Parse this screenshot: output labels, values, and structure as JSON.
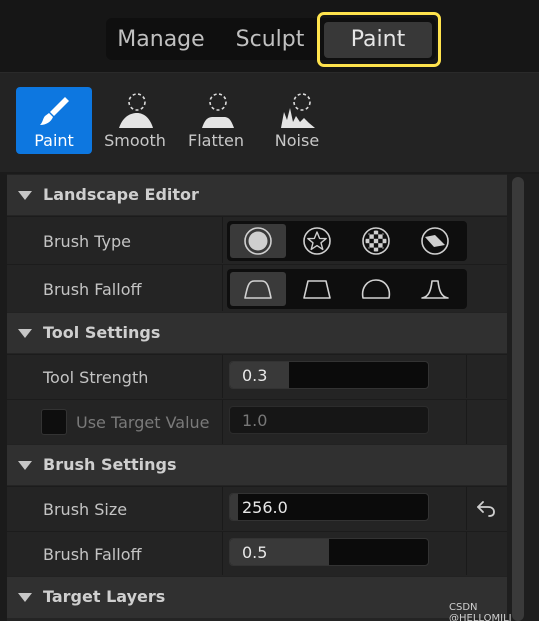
{
  "modes": {
    "tabs": [
      {
        "label": "Manage",
        "active": false
      },
      {
        "label": "Sculpt",
        "active": false
      },
      {
        "label": "Paint",
        "active": true
      }
    ],
    "highlight_color": "#ffe34d"
  },
  "tools": [
    {
      "label": "Paint",
      "icon": "paint-brush-icon",
      "active": true
    },
    {
      "label": "Smooth",
      "icon": "smooth-icon",
      "active": false
    },
    {
      "label": "Flatten",
      "icon": "flatten-icon",
      "active": false
    },
    {
      "label": "Noise",
      "icon": "noise-icon",
      "active": false
    }
  ],
  "sections": {
    "landscape_editor": "Landscape Editor",
    "tool_settings": "Tool Settings",
    "brush_settings": "Brush Settings",
    "target_layers": "Target Layers"
  },
  "landscape_editor": {
    "brush_type_label": "Brush Type",
    "brush_type_options": [
      "circle-brush-icon",
      "alpha-brush-icon",
      "pattern-brush-icon",
      "component-brush-icon"
    ],
    "brush_type_selected": 0,
    "brush_falloff_label": "Brush Falloff",
    "brush_falloff_options": [
      "smooth-falloff-icon",
      "linear-falloff-icon",
      "spherical-falloff-icon",
      "tip-falloff-icon"
    ],
    "brush_falloff_selected": 0
  },
  "tool_settings": {
    "tool_strength_label": "Tool Strength",
    "tool_strength_value": "0.3",
    "tool_strength_fraction": 0.3,
    "use_target_value_label": "Use Target Value",
    "use_target_value_checked": false,
    "target_value": "1.0"
  },
  "brush_settings": {
    "brush_size_label": "Brush Size",
    "brush_size_value": "256.0",
    "brush_size_fraction": 0.04,
    "brush_falloff_label": "Brush Falloff",
    "brush_falloff_value": "0.5",
    "brush_falloff_fraction": 0.5
  },
  "colors": {
    "accent": "#0d77e0"
  },
  "watermark": "CSDN @HELLOMILI"
}
